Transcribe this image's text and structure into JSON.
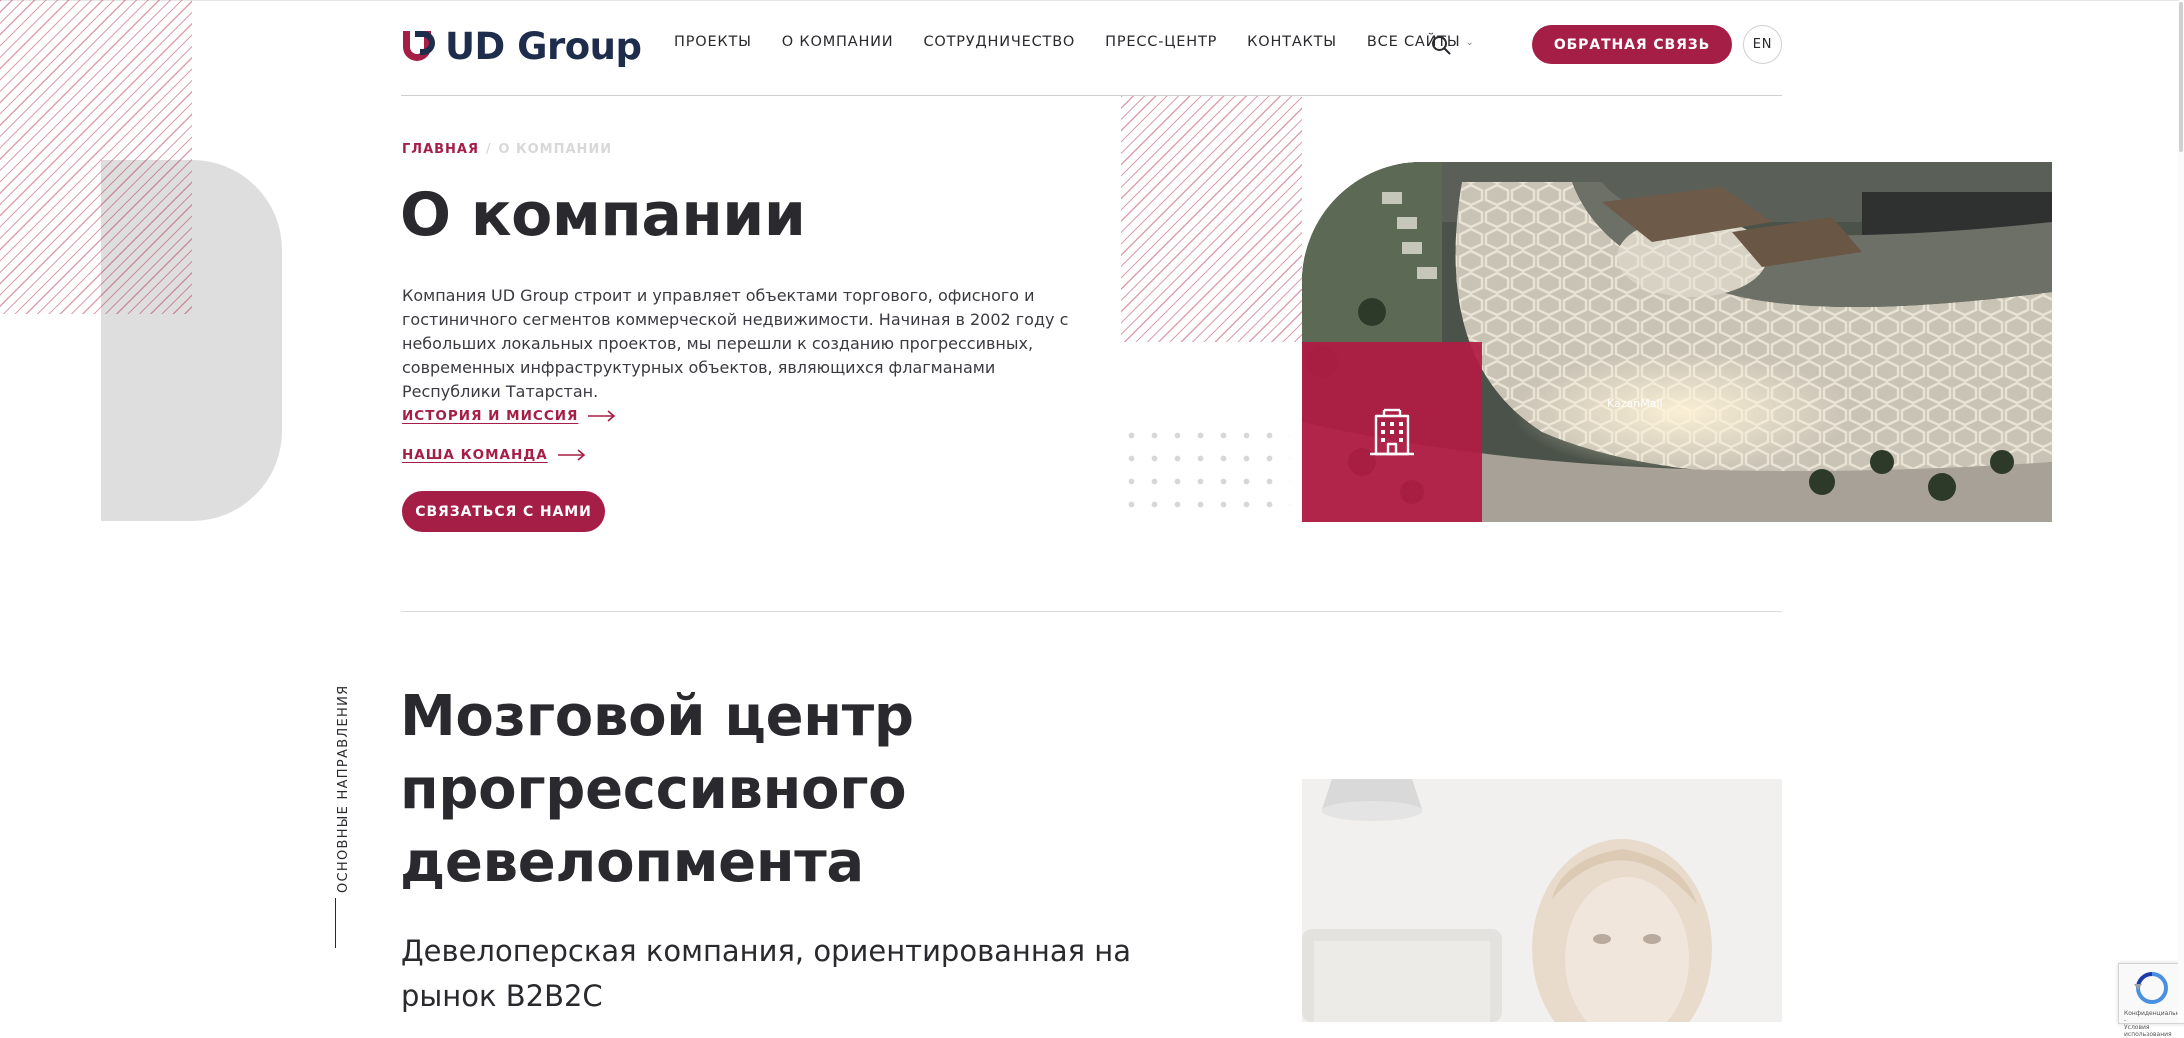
{
  "header": {
    "logo_text": "UD Group",
    "nav": [
      {
        "label": "ПРОЕКТЫ"
      },
      {
        "label": "О КОМПАНИИ"
      },
      {
        "label": "СОТРУДНИЧЕСТВО"
      },
      {
        "label": "ПРЕСС-ЦЕНТР"
      },
      {
        "label": "КОНТАКТЫ"
      },
      {
        "label": "ВСЕ САЙТЫ",
        "icon": "chevron-down-icon"
      }
    ],
    "search_icon": "search-icon",
    "feedback_label": "ОБРАТНАЯ СВЯЗЬ",
    "lang_label": "EN"
  },
  "breadcrumb": {
    "home": "ГЛАВНАЯ",
    "separator": "/",
    "current": "О КОМПАНИИ"
  },
  "hero": {
    "title": "О компании",
    "intro": "Компания UD Group строит и управляет объектами торгового, офисного и гостиничного сегментов коммерческой недвижимости. Начиная в 2002 году с небольших локальных проектов, мы перешли к созданию прогрессивных, современных инфраструктурных объектов, являющихся флагманами Республики Татарстан.",
    "links": [
      {
        "label": "ИСТОРИЯ И МИССИЯ",
        "icon": "arrow-right-icon"
      },
      {
        "label": "НАША КОМАНДА",
        "icon": "arrow-right-icon"
      }
    ],
    "cta_label": "СВЯЗАТЬСЯ С НАМИ",
    "building_icon": "building-icon",
    "photo_sign": "KazanMall"
  },
  "section": {
    "side_label": "ОСНОВНЫЕ НАПРАВЛЕНИЯ",
    "title_lines": [
      "Мозговой центр",
      "прогрессивного",
      "девелопмента"
    ],
    "subtitle": "Девелоперская компания, ориентированная на рынок B2B2C"
  },
  "recaptcha": {
    "text": "Конфиденциальность -\nУсловия использования"
  },
  "colors": {
    "brand": "#a51e45",
    "logo": "#1f2d4d",
    "text": "#2a2a2e"
  }
}
